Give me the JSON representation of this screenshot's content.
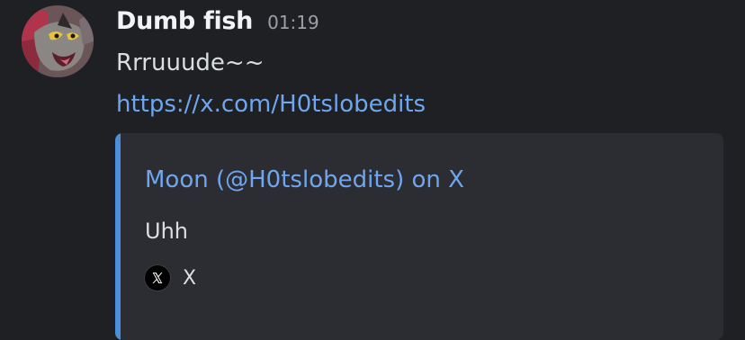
{
  "message": {
    "author": "Dumb fish",
    "timestamp": "01:19",
    "content": "Rrruuude~~",
    "link": "https://x.com/H0tslobedits"
  },
  "embed": {
    "title": "Moon (@H0tslobedits) on X",
    "description": "Uhh",
    "footer_text": "X",
    "footer_icon": "x-logo-icon",
    "accent_color": "#4a8fdd"
  },
  "colors": {
    "background": "#1f2024",
    "link": "#6ea6ef",
    "embed_background": "#2b2d33"
  }
}
